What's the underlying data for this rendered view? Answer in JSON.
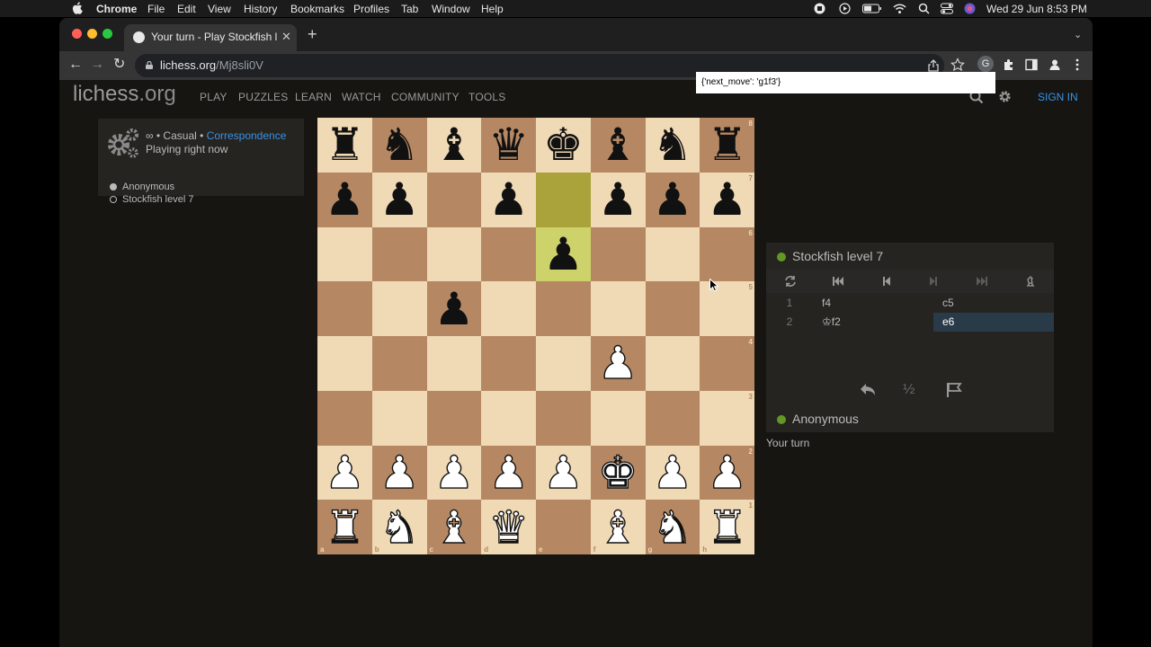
{
  "menubar": {
    "app_name": "Chrome",
    "menus": [
      "File",
      "Edit",
      "View",
      "History",
      "Bookmarks",
      "Profiles",
      "Tab",
      "Window",
      "Help"
    ],
    "clock": "Wed 29 Jun  8:53 PM"
  },
  "browser": {
    "tab_title": "Your turn - Play Stockfish level 7",
    "url_host": "lichess.org",
    "url_path": "/Mj8sli0V",
    "extension_letter": "G"
  },
  "header": {
    "logo_main": "lichess",
    "logo_tld": ".org",
    "nav": [
      "PLAY",
      "PUZZLES",
      "LEARN",
      "WATCH",
      "COMMUNITY",
      "TOOLS"
    ],
    "signin": "SIGN IN"
  },
  "tooltip": {
    "text": "{'next_move': 'g1f3'}"
  },
  "game_info": {
    "line1_prefix": "∞ • Casual • ",
    "line1_link": "Correspondence",
    "line2": "Playing right now",
    "players": [
      "Anonymous",
      "Stockfish level 7"
    ]
  },
  "board": {
    "position": [
      [
        "r",
        "n",
        "b",
        "q",
        "k",
        "b",
        "n",
        "r"
      ],
      [
        "p",
        "p",
        "",
        "p",
        "",
        "p",
        "p",
        "p"
      ],
      [
        "",
        "",
        "",
        "",
        "p",
        "",
        "",
        ""
      ],
      [
        "",
        "",
        "p",
        "",
        "",
        "",
        "",
        ""
      ],
      [
        "",
        "",
        "",
        "",
        "",
        "P",
        "",
        ""
      ],
      [
        "",
        "",
        "",
        "",
        "",
        "",
        "",
        ""
      ],
      [
        "P",
        "P",
        "P",
        "P",
        "P",
        "K",
        "P",
        "P"
      ],
      [
        "R",
        "N",
        "B",
        "Q",
        "",
        "B",
        "N",
        "R"
      ]
    ],
    "highlight_squares": [
      "e7",
      "e6"
    ],
    "files": [
      "a",
      "b",
      "c",
      "d",
      "e",
      "f",
      "g",
      "h"
    ],
    "ranks": [
      "8",
      "7",
      "6",
      "5",
      "4",
      "3",
      "2",
      "1"
    ]
  },
  "panel": {
    "opponent": "Stockfish level 7",
    "player": "Anonymous",
    "moves": [
      {
        "num": "1",
        "white": "f4",
        "black": "c5"
      },
      {
        "num": "2",
        "white": "♔f2",
        "black": "e6"
      }
    ],
    "active_move": "e6",
    "draw_label": "½",
    "status": "Your turn"
  },
  "colors": {
    "light_square": "#f0d9b5",
    "dark_square": "#b58863",
    "link_blue": "#3692e7",
    "online_green": "#629924",
    "page_bg": "#161512"
  }
}
